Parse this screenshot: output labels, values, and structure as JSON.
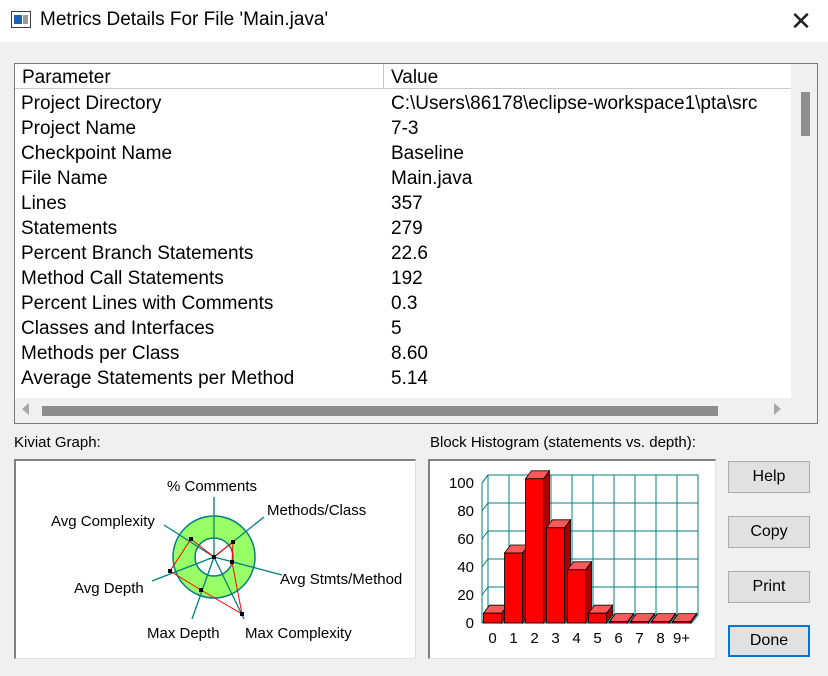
{
  "window": {
    "title": "Metrics Details For File 'Main.java'",
    "close_glyph": "✕"
  },
  "table": {
    "columns": [
      "Parameter",
      "Value"
    ],
    "rows": [
      {
        "parameter": "Project Directory",
        "value": "C:\\Users\\86178\\eclipse-workspace1\\pta\\src"
      },
      {
        "parameter": "Project Name",
        "value": "7-3"
      },
      {
        "parameter": "Checkpoint Name",
        "value": "Baseline"
      },
      {
        "parameter": "File Name",
        "value": "Main.java"
      },
      {
        "parameter": "Lines",
        "value": "357"
      },
      {
        "parameter": "Statements",
        "value": "279"
      },
      {
        "parameter": "Percent Branch Statements",
        "value": "22.6"
      },
      {
        "parameter": "Method Call Statements",
        "value": "192"
      },
      {
        "parameter": "Percent Lines with Comments",
        "value": "0.3"
      },
      {
        "parameter": "Classes and Interfaces",
        "value": "5"
      },
      {
        "parameter": "Methods per Class",
        "value": "8.60"
      },
      {
        "parameter": "Average Statements per Method",
        "value": "5.14"
      }
    ]
  },
  "kiviat": {
    "label": "Kiviat Graph:",
    "axes": [
      "% Comments",
      "Methods/Class",
      "Avg Stmts/Method",
      "Max Complexity",
      "Max Depth",
      "Avg Depth",
      "Avg Complexity"
    ]
  },
  "histogram": {
    "label": "Block Histogram (statements vs. depth):",
    "y_ticks": [
      "100",
      "80",
      "60",
      "40",
      "20",
      "0"
    ],
    "categories": [
      "0",
      "1",
      "2",
      "3",
      "4",
      "5",
      "6",
      "7",
      "8",
      "9+"
    ]
  },
  "chart_data": {
    "type": "bar",
    "categories": [
      "0",
      "1",
      "2",
      "3",
      "4",
      "5",
      "6",
      "7",
      "8",
      "9+"
    ],
    "values": [
      7,
      50,
      103,
      68,
      38,
      7,
      1,
      1,
      1,
      1
    ],
    "ylim": [
      0,
      100
    ],
    "colors": {
      "bar": "#ff0000",
      "bar_side": "#aa0000",
      "bar_top": "#ff5a5a",
      "grid": "#008080"
    }
  },
  "buttons": {
    "help": "Help",
    "copy": "Copy",
    "print": "Print",
    "done": "Done"
  },
  "colors": {
    "accent": "#0078d7",
    "kiviat_ring": "#99ff66",
    "kiviat_axis": "#008080",
    "kiviat_poly": "#ff0000"
  }
}
